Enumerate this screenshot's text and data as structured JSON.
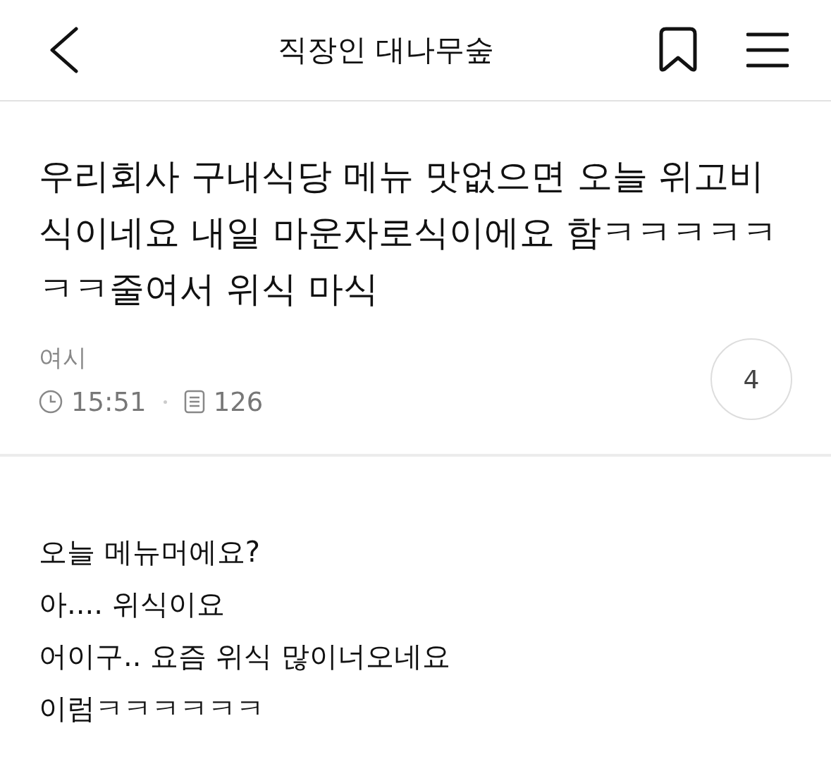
{
  "header": {
    "title": "직장인 대나무숲"
  },
  "post": {
    "title": "우리회사 구내식당 메뉴 맛없으면 오늘 위고비식이네요 내일 마운자로식이에요 함ㅋㅋㅋㅋㅋㅋㅋ줄여서 위식 마식",
    "author": "여시",
    "time": "15:51",
    "views": "126",
    "comment_count": "4"
  },
  "body": {
    "lines": [
      "오늘 메뉴머에요?",
      "아.... 위식이요",
      "어이구.. 요즘 위식 많이너오네요",
      "이럼ㅋㅋㅋㅋㅋㅋ"
    ]
  }
}
